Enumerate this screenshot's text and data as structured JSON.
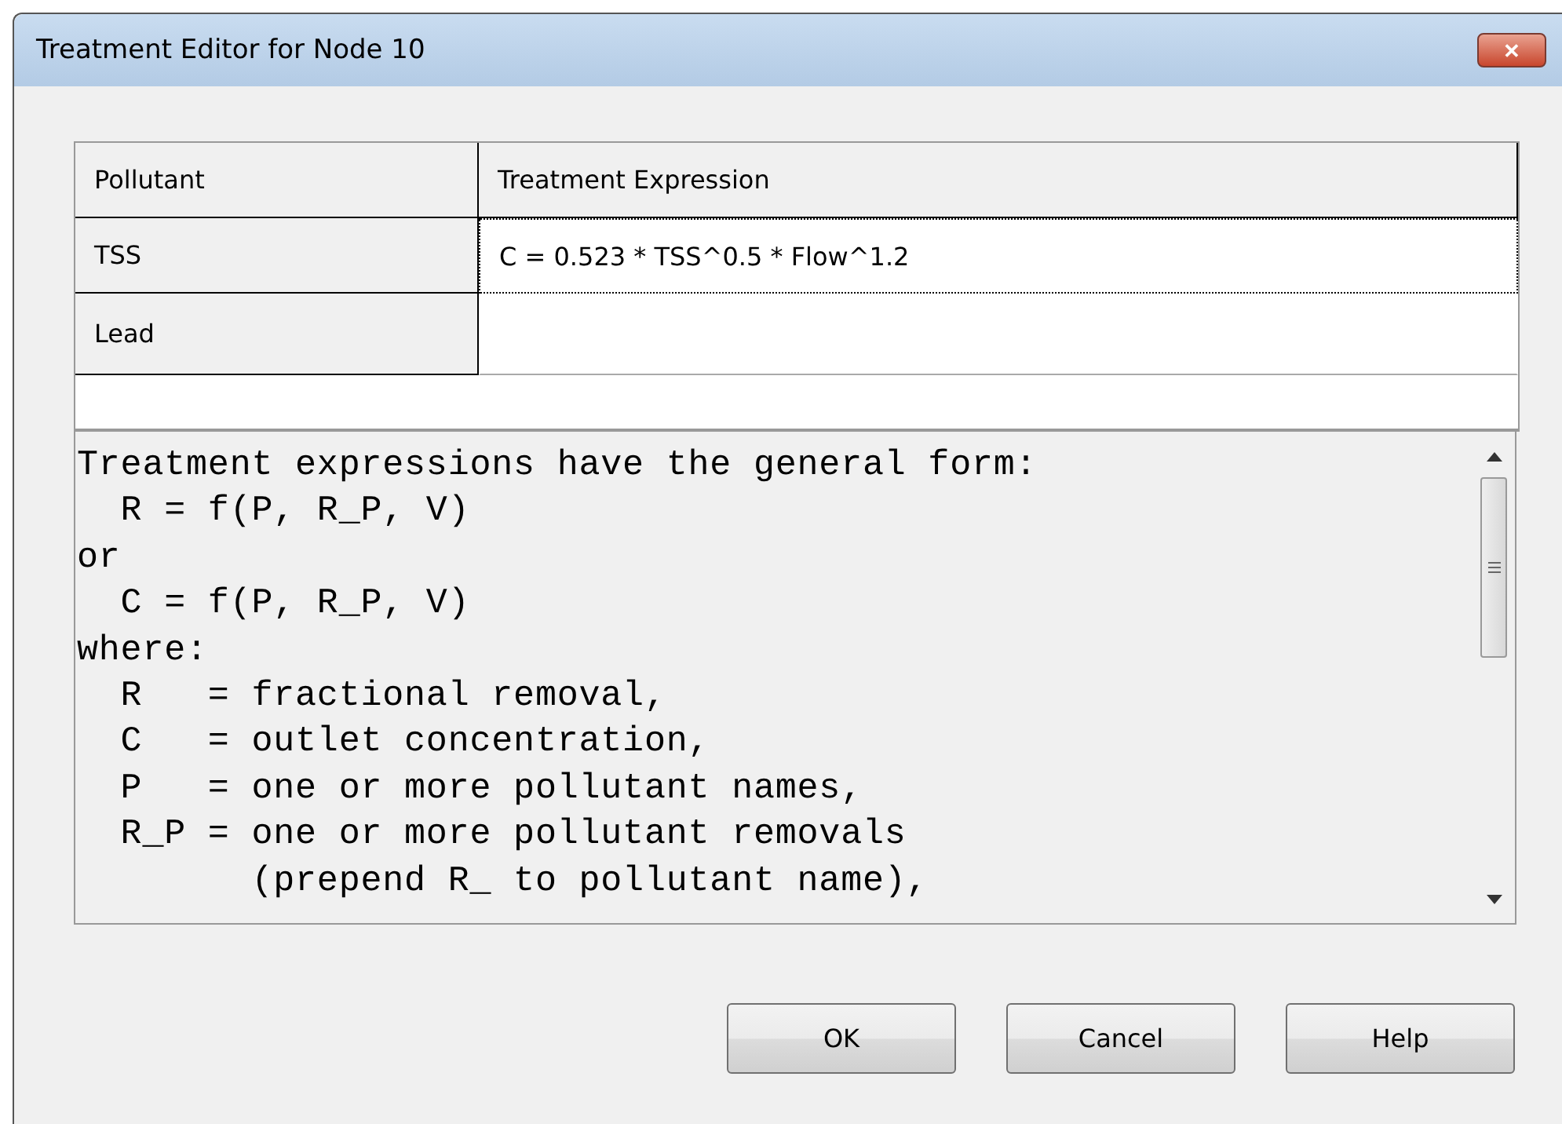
{
  "window": {
    "title": "Treatment Editor for Node 10",
    "close": "✕"
  },
  "table": {
    "columns": [
      "Pollutant",
      "Treatment Expression"
    ],
    "rows": [
      {
        "pollutant": "TSS",
        "expression": "C = 0.523 * TSS^0.5 * Flow^1.2",
        "selected": true
      },
      {
        "pollutant": "Lead",
        "expression": "",
        "selected": false
      }
    ]
  },
  "help_text": [
    "Treatment expressions have the general form:",
    "  R = f(P, R_P, V)",
    "or",
    "  C = f(P, R_P, V)",
    "where:",
    "  R   = fractional removal,",
    "  C   = outlet concentration,",
    "  P   = one or more pollutant names,",
    "  R_P = one or more pollutant removals",
    "        (prepend R_ to pollutant name),"
  ],
  "buttons": [
    "OK",
    "Cancel",
    "Help"
  ]
}
